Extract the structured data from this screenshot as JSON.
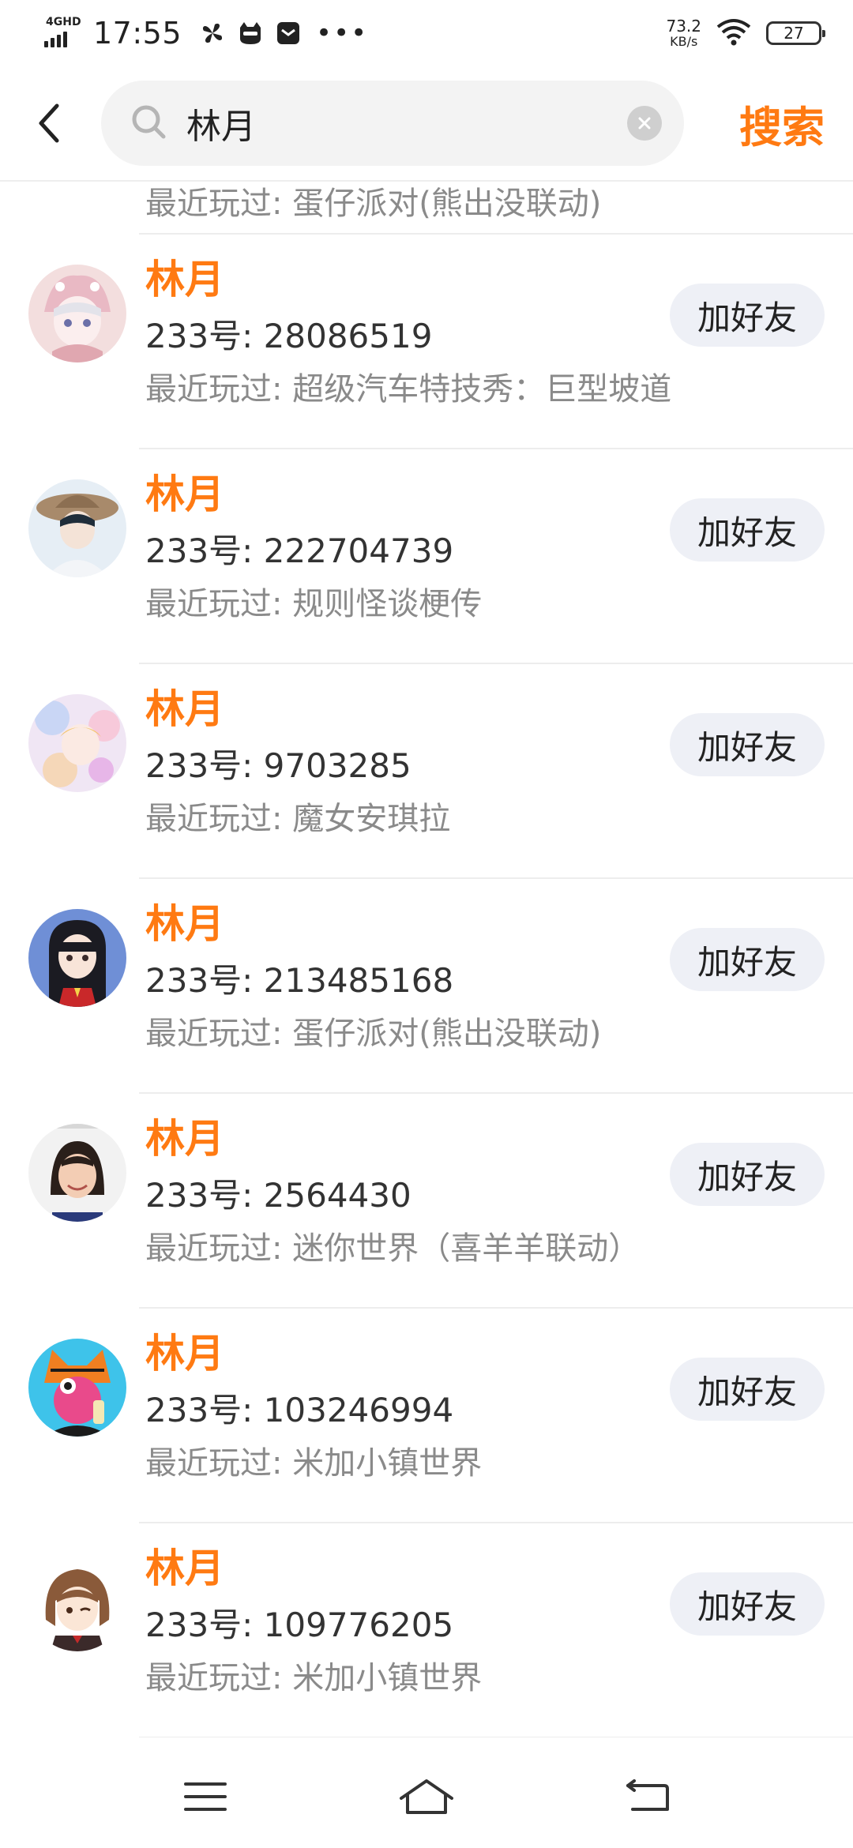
{
  "status_bar": {
    "network": "4GHD",
    "time": "17:55",
    "speed_value": "73.2",
    "speed_unit": "KB/s",
    "battery": "27"
  },
  "header": {
    "search_value": "林月",
    "search_button": "搜索"
  },
  "partial_row": {
    "recent": "最近玩过: 蛋仔派对(熊出没联动)"
  },
  "results": [
    {
      "name": "林月",
      "uid": "233号: 28086519",
      "recent": "最近玩过: 超级汽车特技秀：巨型坡道",
      "button": "加好友",
      "avatar": "avatar-anime-girl-hat"
    },
    {
      "name": "林月",
      "uid": "233号: 222704739",
      "recent": "最近玩过: 规则怪谈梗传",
      "button": "加好友",
      "avatar": "avatar-anime-boy-hat"
    },
    {
      "name": "林月",
      "uid": "233号: 9703285",
      "recent": "最近玩过: 魔女安琪拉",
      "button": "加好友",
      "avatar": "avatar-pastel-girl"
    },
    {
      "name": "林月",
      "uid": "233号: 213485168",
      "recent": "最近玩过: 蛋仔派对(熊出没联动)",
      "button": "加好友",
      "avatar": "avatar-black-hair-girl"
    },
    {
      "name": "林月",
      "uid": "233号: 2564430",
      "recent": "最近玩过: 迷你世界（喜羊羊联动）",
      "button": "加好友",
      "avatar": "avatar-photo-child"
    },
    {
      "name": "林月",
      "uid": "233号: 103246994",
      "recent": "最近玩过: 米加小镇世界",
      "button": "加好友",
      "avatar": "avatar-cartoon-cat"
    },
    {
      "name": "林月",
      "uid": "233号: 109776205",
      "recent": "最近玩过: 米加小镇世界",
      "button": "加好友",
      "avatar": "avatar-chibi-girl"
    }
  ],
  "colors": {
    "accent": "#ff7a12",
    "button_bg": "#eef0f6",
    "secondary_text": "#8a8a8a"
  }
}
